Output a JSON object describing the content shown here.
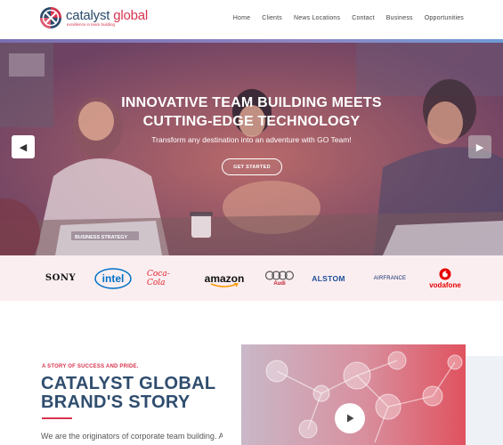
{
  "logo": {
    "name_main": "catalyst",
    "name_accent": " global",
    "tagline": "excellence in team building"
  },
  "nav": [
    "Home",
    "Clients",
    "News Locations",
    "Contact",
    "Business",
    "Opportunities"
  ],
  "hero": {
    "title_line1": "INNOVATIVE TEAM BUILDING MEETS",
    "title_line2": "CUTTING-EDGE TECHNOLOGY",
    "subtitle": "Transform any destination into an adventure with GO Team!",
    "cta": "GET STARTED",
    "prev_icon": "chevron-left-icon",
    "next_icon": "chevron-right-icon",
    "laptop_text": "BUSINESS STRATEGY"
  },
  "brands": [
    "SONY",
    "intel",
    "Coca-Cola",
    "amazon",
    "Audi",
    "ALSTOM",
    "AIRFRANCE",
    "vodafone"
  ],
  "story": {
    "kicker": "A STORY OF SUCCESS AND PRIDE.",
    "title_line1": "CATALYST GLOBAL",
    "title_line2": "BRAND'S STORY",
    "text": "We are the originators of corporate team building. An"
  },
  "colors": {
    "accent": "#d8344f",
    "navy": "#2f4d6e",
    "brand_strip": "#fbeef1"
  }
}
